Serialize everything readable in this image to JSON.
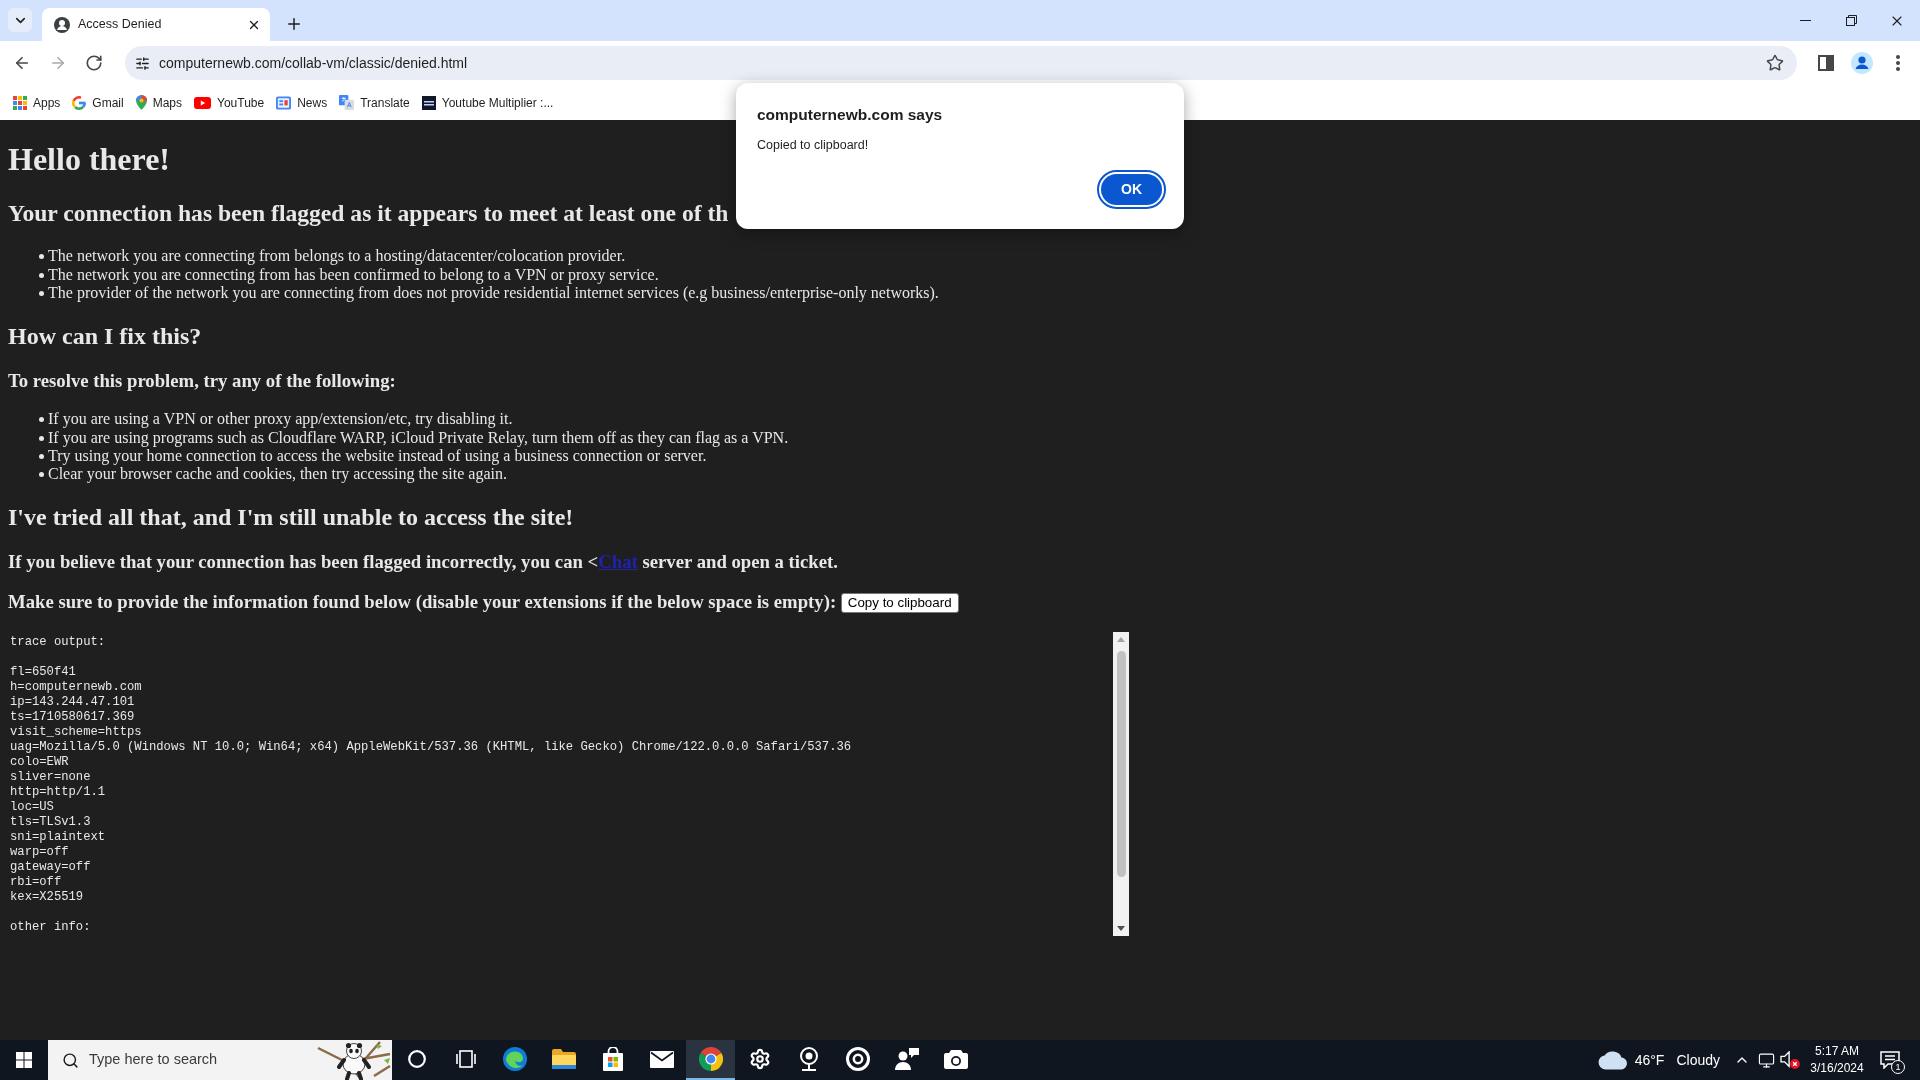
{
  "browser": {
    "tabs": [
      {
        "title": "Access Denied",
        "selected": true
      }
    ],
    "nav_buttons": [
      {
        "kind": "back",
        "disabled": false
      },
      {
        "kind": "forward",
        "disabled": true
      },
      {
        "kind": "reload",
        "disabled": false
      }
    ],
    "address": "computernewb.com/collab-vm/classic/denied.html",
    "bookmarks": [
      {
        "label": "Apps",
        "kind": "apps"
      },
      {
        "label": "Gmail",
        "kind": "gmail"
      },
      {
        "label": "Maps",
        "kind": "maps"
      },
      {
        "label": "YouTube",
        "kind": "youtube"
      },
      {
        "label": "News",
        "kind": "news"
      },
      {
        "label": "Translate",
        "kind": "translate"
      },
      {
        "label": "Youtube Multiplier :...",
        "kind": "ytm"
      }
    ]
  },
  "page": {
    "title": "Hello there!",
    "flag_heading": "Your connection has been flagged as it appears to meet at least one of th",
    "reasons": [
      "The network you are connecting from belongs to a hosting/datacenter/colocation provider.",
      "The network you are connecting from has been confirmed to belong to a VPN or proxy service.",
      "The provider of the network you are connecting from does not provide residential internet services (e.g business/enterprise-only networks)."
    ],
    "fix_heading": "How can I fix this?",
    "fix_intro": "To resolve this problem, try any of the following:",
    "fixes": [
      "If you are using a VPN or other proxy app/extension/etc, try disabling it.",
      "If you are using programs such as Cloudflare WARP, iCloud Private Relay, turn them off as they can flag as a VPN.",
      "Try using your home connection to access the website instead of using a business connection or server.",
      "Clear your browser cache and cookies, then try accessing the site again."
    ],
    "still_heading": "I've tried all that, and I'm still unable to access the site!",
    "contact": {
      "before": "If you believe that your connection has been flagged incorrectly, you can <",
      "link": "Chat",
      "after": "server and open a ticket."
    },
    "info_prompt": "Make sure to provide the information found below (disable your extensions if the below space is empty):",
    "copy_button": "Copy to clipboard",
    "trace": [
      [
        "trace output:"
      ],
      [
        "fl=650f41",
        "h=computernewb.com",
        "ip=143.244.47.101",
        "ts=1710580617.369",
        "visit_scheme=https",
        "uag=Mozilla/5.0 (Windows NT 10.0; Win64; x64) AppleWebKit/537.36 (KHTML, like Gecko) Chrome/122.0.0.0 Safari/537.36",
        "colo=EWR",
        "sliver=none",
        "http=http/1.1",
        "loc=US",
        "tls=TLSv1.3",
        "sni=plaintext",
        "warp=off",
        "gateway=off",
        "rbi=off",
        "kex=X25519"
      ],
      [
        "other info:"
      ]
    ]
  },
  "dialog": {
    "origin": "computernewb.com says",
    "message": "Copied to clipboard!",
    "button": "OK"
  },
  "taskbar": {
    "search_placeholder": "Type here to search",
    "apps": [
      {
        "kind": "cortana",
        "selected": false
      },
      {
        "kind": "task_view",
        "selected": false
      },
      {
        "kind": "edge",
        "selected": false
      },
      {
        "kind": "explorer",
        "selected": false
      },
      {
        "kind": "store",
        "selected": false
      },
      {
        "kind": "mail",
        "selected": false
      },
      {
        "kind": "chrome",
        "selected": true
      },
      {
        "kind": "settings",
        "selected": false
      },
      {
        "kind": "webcam",
        "selected": false
      },
      {
        "kind": "target",
        "selected": false
      },
      {
        "kind": "people",
        "selected": false
      },
      {
        "kind": "camera",
        "selected": false
      }
    ],
    "weather": {
      "temperature": "46°F",
      "condition": "Cloudy"
    },
    "clock": {
      "time": "5:17 AM",
      "date": "3/16/2024"
    },
    "notifications": "1"
  }
}
